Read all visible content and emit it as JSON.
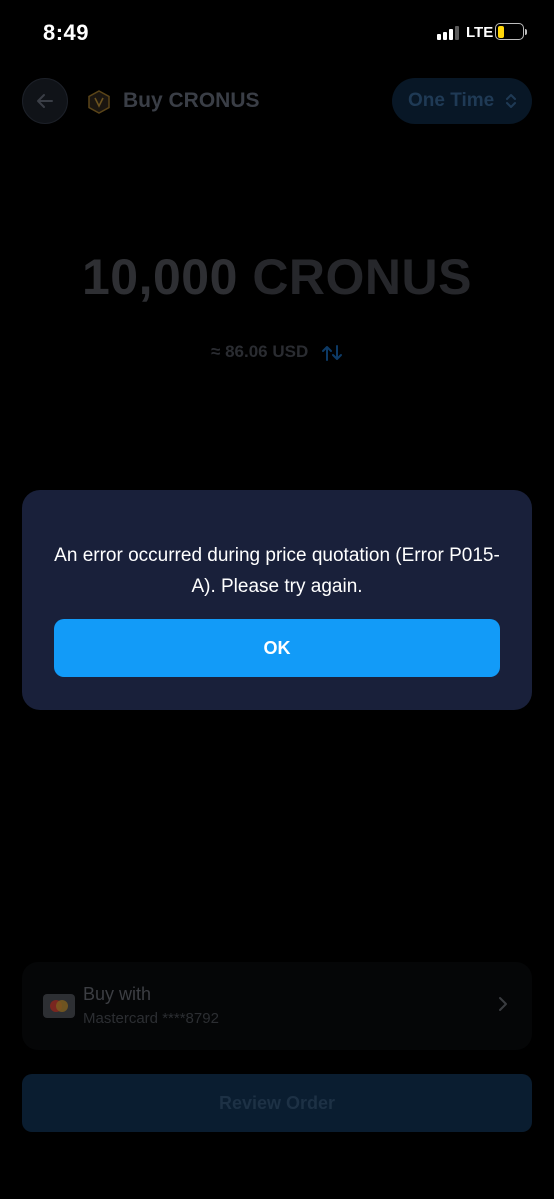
{
  "status_bar": {
    "time": "8:49",
    "network": "LTE"
  },
  "header": {
    "title": "Buy CRONUS",
    "frequency": "One Time"
  },
  "amount": {
    "value": "10,000",
    "symbol": "CRONUS",
    "fiat": "≈ 86.06 USD"
  },
  "payment": {
    "label": "Buy with",
    "method": "Mastercard ****8792"
  },
  "review_button": {
    "label": "Review Order"
  },
  "dialog": {
    "message": "An error occurred during price quotation (Error P015-A). Please try again.",
    "ok_label": "OK"
  },
  "colors": {
    "accent": "#129bf8",
    "dialog_bg": "#19203a",
    "background": "#000000"
  },
  "icons": [
    "back-arrow-icon",
    "token-icon",
    "updown-chevron-icon",
    "swap-arrows-icon",
    "mastercard-icon",
    "chevron-right-icon",
    "signal-icon",
    "battery-icon"
  ]
}
